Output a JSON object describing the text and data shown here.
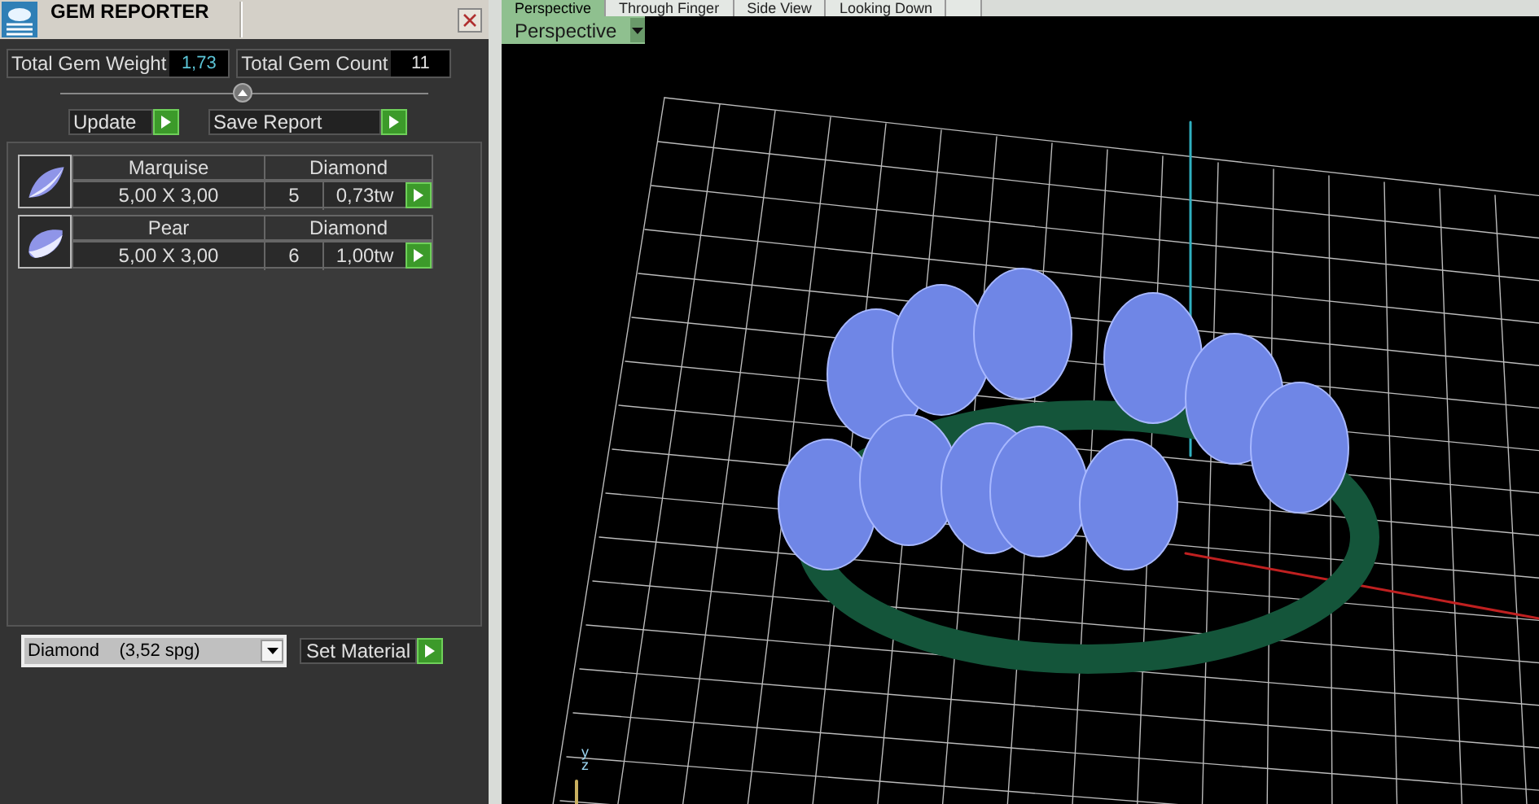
{
  "panel": {
    "title": "GEM REPORTER",
    "totals": [
      {
        "label": "Total Gem Weight",
        "value": "1,73"
      },
      {
        "label": "Total Gem Count",
        "value": "11"
      }
    ],
    "actions": [
      {
        "label": "Update"
      },
      {
        "label": "Save Report"
      }
    ],
    "gems": [
      {
        "kind": "marquise",
        "shape": "Marquise",
        "material": "Diamond",
        "size": "5,00 X 3,00",
        "count": "5",
        "weight": "0,73tw"
      },
      {
        "kind": "pear",
        "shape": "Pear",
        "material": "Diamond",
        "size": "5,00 X 3,00",
        "count": "6",
        "weight": "1,00tw"
      }
    ],
    "material_select": {
      "value": "Diamond    (3,52 spg)"
    },
    "set_button": {
      "label": "Set Material"
    }
  },
  "viewport": {
    "tabs": [
      {
        "label": "Perspective",
        "selected": true
      },
      {
        "label": "Through Finger",
        "selected": false
      },
      {
        "label": "Side View",
        "selected": false
      },
      {
        "label": "Looking Down",
        "selected": false
      }
    ],
    "view_menu": {
      "value": "Perspective"
    },
    "axis_labels": [
      "y",
      "z"
    ]
  }
}
